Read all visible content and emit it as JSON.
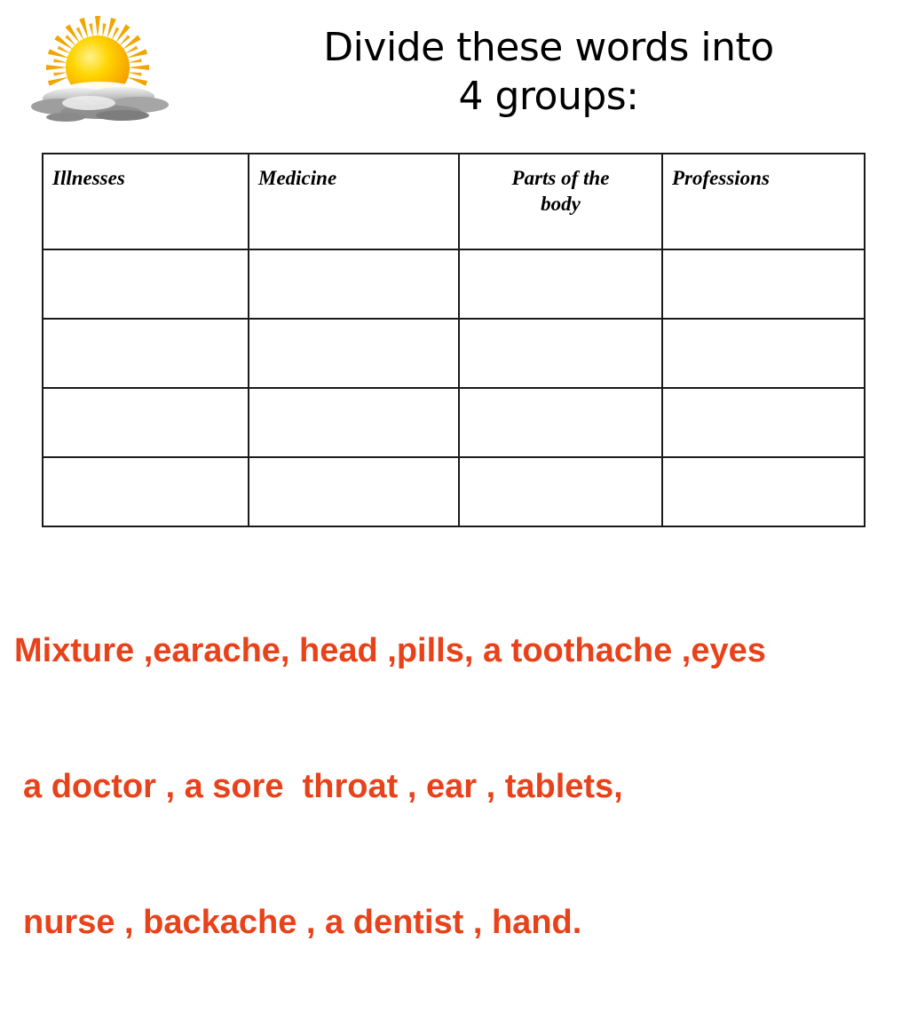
{
  "slide": {
    "background_color": "#ffffff",
    "title": {
      "lines": [
        "Divide these words into",
        "4 groups:"
      ],
      "color": "#000000"
    },
    "clipart": {
      "name": "sun-behind-clouds-image",
      "sun_color": "#ffd000",
      "sun_ray_color": "#f0a500",
      "cloud_color": "#9a9a9a"
    },
    "table": {
      "headers": [
        {
          "label": "Illnesses",
          "wrapped": false
        },
        {
          "label": "Medicine",
          "wrapped": false
        },
        {
          "label": "Parts of the body",
          "wrapped": true,
          "line1": "Parts of the",
          "line2": "body"
        },
        {
          "label": "Professions",
          "wrapped": false
        }
      ],
      "rows": [
        [
          "",
          "",
          "",
          ""
        ],
        [
          "",
          "",
          "",
          ""
        ],
        [
          "",
          "",
          "",
          ""
        ],
        [
          "",
          "",
          "",
          ""
        ]
      ],
      "row_count": 4,
      "column_count": 4,
      "border_color": "#1a1a1a"
    },
    "word_bank": {
      "color": "#e8421a",
      "lines": [
        "Mixture ,earache, head ,pills, a toothache ,eyes",
        "a doctor , a sore  throat , ear , tablets,",
        "nurse , backache , a dentist , hand."
      ],
      "words": [
        "Mixture",
        "earache",
        "head",
        "pills",
        "a toothache",
        "eyes",
        "a doctor",
        "a sore throat",
        "ear",
        "tablets",
        "nurse",
        "backache",
        "a dentist",
        "hand"
      ]
    }
  }
}
